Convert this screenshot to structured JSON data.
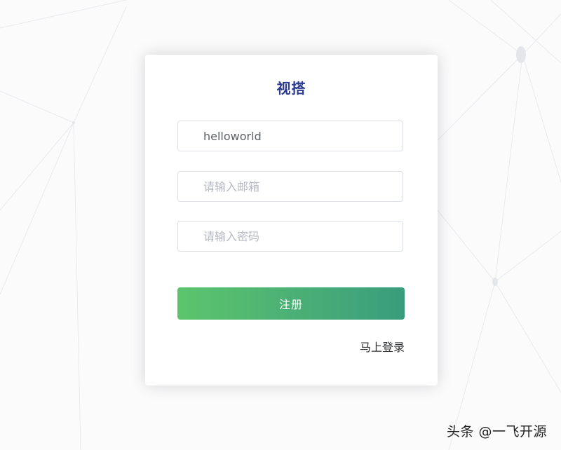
{
  "form": {
    "title": "视搭",
    "username": {
      "value": "helloworld",
      "placeholder": ""
    },
    "email": {
      "value": "",
      "placeholder": "请输入邮箱"
    },
    "password": {
      "value": "",
      "placeholder": "请输入密码"
    },
    "submit_label": "注册",
    "login_link_label": "马上登录"
  },
  "watermark": {
    "text": "头条 @一飞开源"
  },
  "colors": {
    "title": "#2b3a8f",
    "button_start": "#5cc56c",
    "button_end": "#399d7d",
    "background": "#fbfbfc"
  }
}
